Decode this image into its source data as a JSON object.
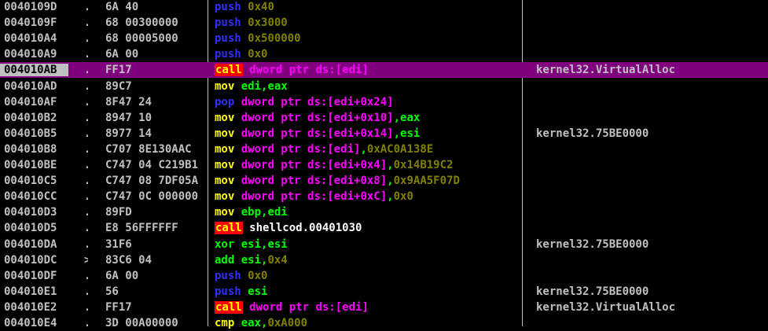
{
  "rows": [
    {
      "addr": "0040109D",
      "mark": ".",
      "hex": "6A 40",
      "mn": "push",
      "mncls": "push",
      "ops": [
        {
          "t": "0x40",
          "c": "op-imm"
        }
      ],
      "comment": ""
    },
    {
      "addr": "0040109F",
      "mark": ".",
      "hex": "68 00300000",
      "mn": "push",
      "mncls": "push",
      "ops": [
        {
          "t": "0x3000",
          "c": "op-imm"
        }
      ],
      "comment": ""
    },
    {
      "addr": "004010A4",
      "mark": ".",
      "hex": "68 00005000",
      "mn": "push",
      "mncls": "push",
      "ops": [
        {
          "t": "0x500000",
          "c": "op-imm"
        }
      ],
      "comment": ""
    },
    {
      "addr": "004010A9",
      "mark": ".",
      "hex": "6A 00",
      "mn": "push",
      "mncls": "push",
      "ops": [
        {
          "t": "0x0",
          "c": "op-imm"
        }
      ],
      "comment": ""
    },
    {
      "addr": "004010AB",
      "mark": ".",
      "hex": "FF17",
      "mn": "call",
      "mncls": "call",
      "ops": [
        {
          "t": "dword ptr ds:[edi]",
          "c": "op-mem"
        }
      ],
      "comment": "kernel32.VirtualAlloc",
      "selected": true
    },
    {
      "addr": "004010AD",
      "mark": ".",
      "hex": "89C7",
      "mn": "mov",
      "mncls": "mov",
      "ops": [
        {
          "t": "edi,eax",
          "c": "op-reg"
        }
      ],
      "comment": ""
    },
    {
      "addr": "004010AF",
      "mark": ".",
      "hex": "8F47 24",
      "mn": "pop",
      "mncls": "pop",
      "ops": [
        {
          "t": "dword ptr ds:[edi+0x24]",
          "c": "op-mem"
        }
      ],
      "comment": ""
    },
    {
      "addr": "004010B2",
      "mark": ".",
      "hex": "8947 10",
      "mn": "mov",
      "mncls": "mov",
      "ops": [
        {
          "t": "dword ptr ds:[edi+0x10]",
          "c": "op-mem"
        },
        {
          "t": ",eax",
          "c": "op-reg"
        }
      ],
      "comment": ""
    },
    {
      "addr": "004010B5",
      "mark": ".",
      "hex": "8977 14",
      "mn": "mov",
      "mncls": "mov",
      "ops": [
        {
          "t": "dword ptr ds:[edi+0x14]",
          "c": "op-mem"
        },
        {
          "t": ",esi",
          "c": "op-reg"
        }
      ],
      "comment": "kernel32.75BE0000"
    },
    {
      "addr": "004010B8",
      "mark": ".",
      "hex": "C707 8E130AAC",
      "mn": "mov",
      "mncls": "mov",
      "ops": [
        {
          "t": "dword ptr ds:[edi]",
          "c": "op-mem"
        },
        {
          "t": ",",
          "c": "op-punct"
        },
        {
          "t": "0xAC0A138E",
          "c": "op-num"
        }
      ],
      "comment": ""
    },
    {
      "addr": "004010BE",
      "mark": ".",
      "hex": "C747 04 C219B1",
      "mn": "mov",
      "mncls": "mov",
      "ops": [
        {
          "t": "dword ptr ds:[edi+0x4]",
          "c": "op-mem"
        },
        {
          "t": ",",
          "c": "op-punct"
        },
        {
          "t": "0x14B19C2",
          "c": "op-num"
        }
      ],
      "comment": ""
    },
    {
      "addr": "004010C5",
      "mark": ".",
      "hex": "C747 08 7DF05A",
      "mn": "mov",
      "mncls": "mov",
      "ops": [
        {
          "t": "dword ptr ds:[edi+0x8]",
          "c": "op-mem"
        },
        {
          "t": ",",
          "c": "op-punct"
        },
        {
          "t": "0x9AA5F07D",
          "c": "op-num"
        }
      ],
      "comment": ""
    },
    {
      "addr": "004010CC",
      "mark": ".",
      "hex": "C747 0C 000000",
      "mn": "mov",
      "mncls": "mov",
      "ops": [
        {
          "t": "dword ptr ds:[edi+0xC]",
          "c": "op-mem"
        },
        {
          "t": ",",
          "c": "op-punct"
        },
        {
          "t": "0x0",
          "c": "op-num"
        }
      ],
      "comment": ""
    },
    {
      "addr": "004010D3",
      "mark": ".",
      "hex": "89FD",
      "mn": "mov",
      "mncls": "mov",
      "ops": [
        {
          "t": "ebp,edi",
          "c": "op-reg"
        }
      ],
      "comment": ""
    },
    {
      "addr": "004010D5",
      "mark": ".",
      "hex": "E8 56FFFFFF",
      "mn": "call",
      "mncls": "call",
      "ops": [
        {
          "t": "shellcod.00401030",
          "c": "op-lbl"
        }
      ],
      "comment": ""
    },
    {
      "addr": "004010DA",
      "mark": ".",
      "hex": "31F6",
      "mn": "xor",
      "mncls": "xor",
      "ops": [
        {
          "t": "esi,esi",
          "c": "op-reg"
        }
      ],
      "comment": "kernel32.75BE0000"
    },
    {
      "addr": "004010DC",
      "mark": ">",
      "hex": "83C6 04",
      "mn": "add",
      "mncls": "add",
      "ops": [
        {
          "t": "esi,",
          "c": "op-reg"
        },
        {
          "t": "0x4",
          "c": "op-num"
        }
      ],
      "comment": ""
    },
    {
      "addr": "004010DF",
      "mark": ".",
      "hex": "6A 00",
      "mn": "push",
      "mncls": "push",
      "ops": [
        {
          "t": "0x0",
          "c": "op-imm"
        }
      ],
      "comment": ""
    },
    {
      "addr": "004010E1",
      "mark": ".",
      "hex": "56",
      "mn": "push",
      "mncls": "push",
      "ops": [
        {
          "t": "esi",
          "c": "op-reg"
        }
      ],
      "comment": "kernel32.75BE0000"
    },
    {
      "addr": "004010E2",
      "mark": ".",
      "hex": "FF17",
      "mn": "call",
      "mncls": "call",
      "ops": [
        {
          "t": "dword ptr ds:[edi]",
          "c": "op-mem"
        }
      ],
      "comment": "kernel32.VirtualAlloc"
    },
    {
      "addr": "004010E4",
      "mark": ".",
      "hex": "3D 00A00000",
      "mn": "cmp",
      "mncls": "cmp",
      "ops": [
        {
          "t": "eax,",
          "c": "op-reg"
        },
        {
          "t": "0xA000",
          "c": "op-num"
        }
      ],
      "comment": ""
    }
  ],
  "colors": {
    "background": "#000000",
    "selection": "#800080",
    "call_highlight": "#ff0000"
  }
}
